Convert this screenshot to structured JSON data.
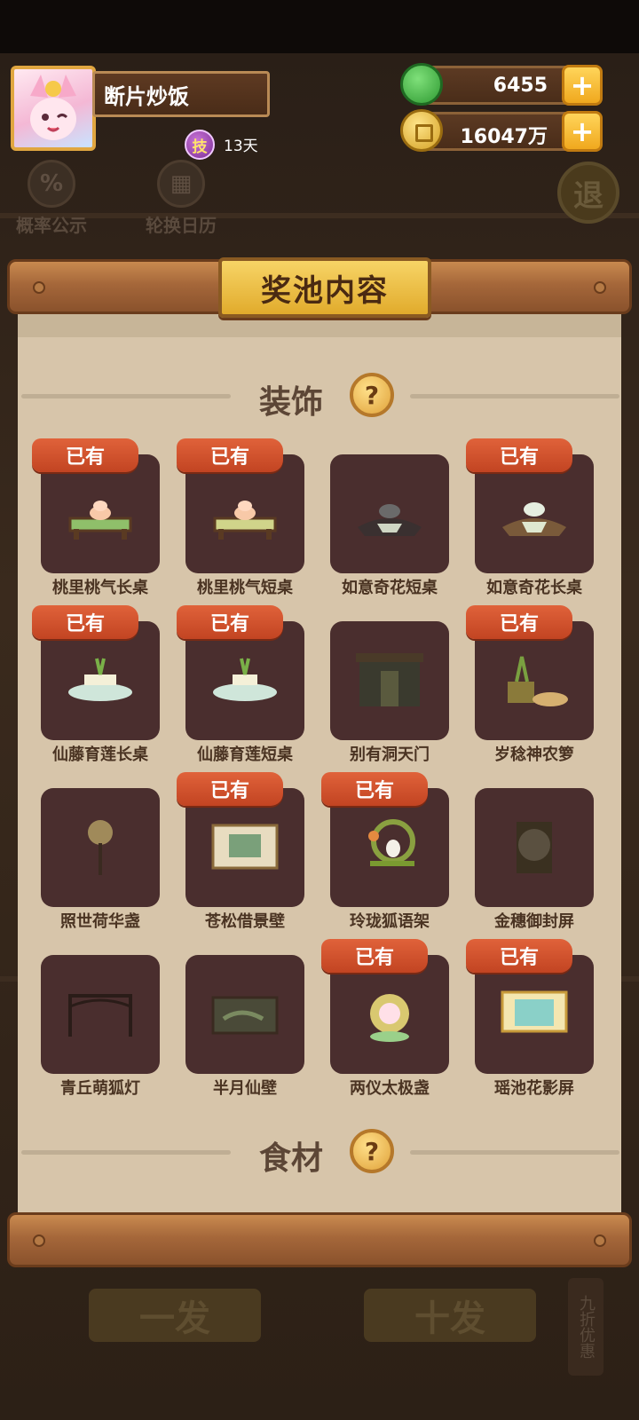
{
  "player": {
    "name": "断片炒饭",
    "skill_badge": "技",
    "skill_days": "13天"
  },
  "currency": {
    "jade": "6455",
    "coins": "16047万"
  },
  "background": {
    "prob_label": "概率公示",
    "calendar_label": "轮换日历",
    "exit_label": "退",
    "draw_one": "一发",
    "draw_ten": "十发",
    "discount": "九折优惠"
  },
  "panel": {
    "title": "奖池内容"
  },
  "sections": {
    "decor": {
      "label": "装饰",
      "help": "?"
    },
    "food": {
      "label": "食材",
      "help": "?"
    }
  },
  "owned_label": "已有",
  "items": [
    {
      "name": "桃里桃气长桌",
      "owned": true,
      "icon": "peach-long-table-icon"
    },
    {
      "name": "桃里桃气短桌",
      "owned": true,
      "icon": "peach-short-table-icon"
    },
    {
      "name": "如意奇花短桌",
      "owned": false,
      "icon": "ruyi-short-table-icon"
    },
    {
      "name": "如意奇花长桌",
      "owned": true,
      "icon": "ruyi-long-table-icon"
    },
    {
      "name": "仙藤育莲长桌",
      "owned": true,
      "icon": "lotus-long-table-icon"
    },
    {
      "name": "仙藤育莲短桌",
      "owned": true,
      "icon": "lotus-short-table-icon"
    },
    {
      "name": "别有洞天门",
      "owned": false,
      "icon": "gate-icon"
    },
    {
      "name": "岁稔神农箩",
      "owned": true,
      "icon": "harvest-basket-icon"
    },
    {
      "name": "照世荷华盏",
      "owned": false,
      "icon": "lotus-lamp-icon"
    },
    {
      "name": "苍松借景壁",
      "owned": true,
      "icon": "pine-wall-icon"
    },
    {
      "name": "玲珑狐语架",
      "owned": true,
      "icon": "fox-shelf-icon"
    },
    {
      "name": "金穗御封屏",
      "owned": false,
      "icon": "golden-screen-icon"
    },
    {
      "name": "青丘萌狐灯",
      "owned": false,
      "icon": "fox-lantern-icon"
    },
    {
      "name": "半月仙壁",
      "owned": false,
      "icon": "halfmoon-wall-icon"
    },
    {
      "name": "两仪太极盏",
      "owned": true,
      "icon": "taiji-lamp-icon"
    },
    {
      "name": "瑶池花影屏",
      "owned": true,
      "icon": "flower-screen-icon"
    }
  ]
}
